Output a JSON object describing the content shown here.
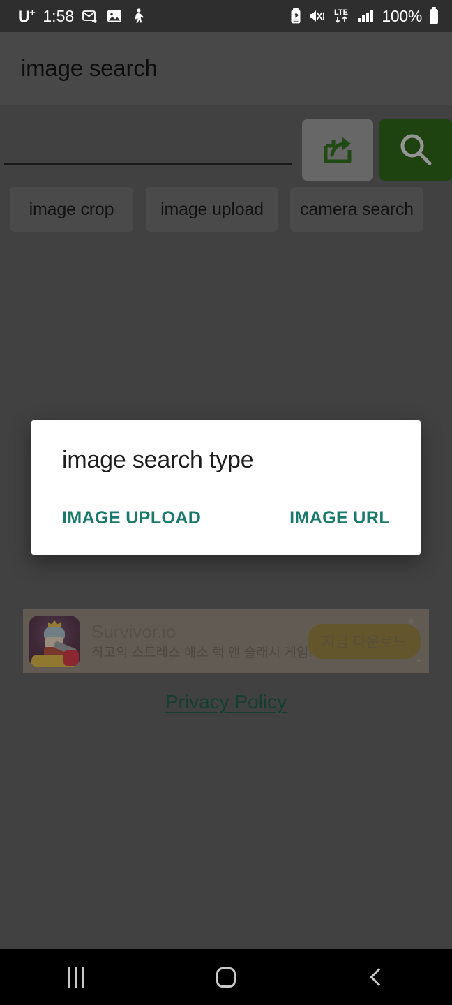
{
  "status_bar": {
    "carrier": "U",
    "carrier_sup": "+",
    "time": "1:58",
    "battery_percent": "100%",
    "network_type": "LTE",
    "left_icons": [
      "email-icon",
      "gallery-image-icon",
      "person-walking-icon"
    ],
    "right_icons": [
      "battery-saver-icon",
      "sound-mute-vibrate-icon",
      "lte-data-icon",
      "signal-bars-icon",
      "battery-icon"
    ]
  },
  "app_bar": {
    "title": "image search"
  },
  "search": {
    "input_value": "",
    "input_placeholder": "",
    "share_button_label": "share-image",
    "search_button_label": "search"
  },
  "chips": [
    {
      "label": "image crop"
    },
    {
      "label": "image upload"
    },
    {
      "label": "camera search"
    }
  ],
  "ad": {
    "title": "Survivor.io",
    "subtitle": "최고의 스트레스 해소 핵 앤 슬래시 게임!",
    "cta_label": "지금 다운로드",
    "sparkle_a": "✦",
    "sparkle_b": "✦"
  },
  "footer": {
    "privacy_policy": "Privacy Policy"
  },
  "dialog": {
    "title": "image search type",
    "buttons": [
      {
        "label": "IMAGE UPLOAD"
      },
      {
        "label": "IMAGE URL"
      }
    ]
  },
  "nav_bar": {
    "recents_label": "recents",
    "home_label": "home",
    "back_label": "back"
  },
  "colors": {
    "status_bar_bg": "#2e2e2e",
    "app_bar_bg": "#676767",
    "content_bg": "#5d5d5d",
    "search_button_green": "#2c5f17",
    "dialog_accent_teal": "#1a7a6b",
    "privacy_link": "#1f5a47",
    "nav_bar_bg": "#000000"
  }
}
